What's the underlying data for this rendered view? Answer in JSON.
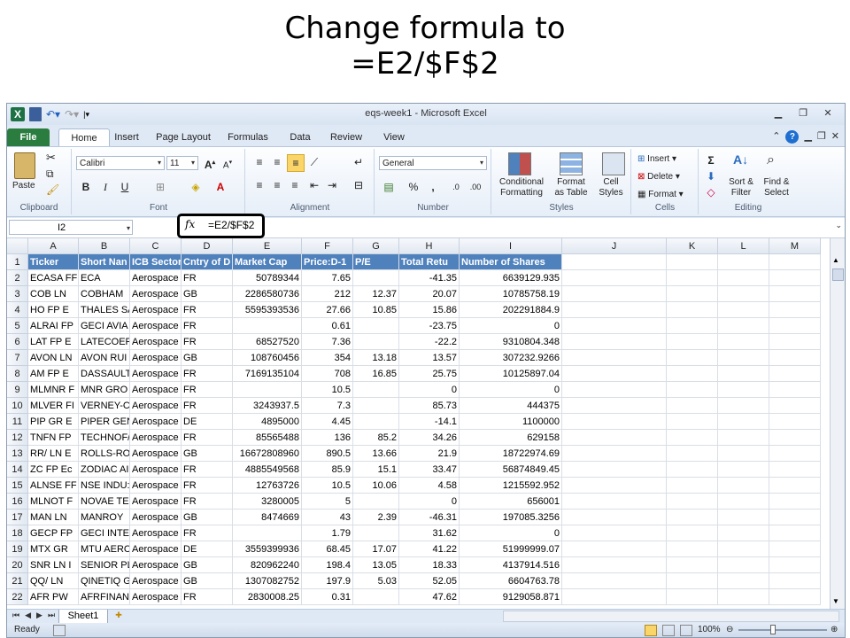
{
  "slide": {
    "title_line1": "Change formula to",
    "title_line2": "=E2/$F$2"
  },
  "window": {
    "title": "eqs-week1 - Microsoft Excel"
  },
  "tabs": {
    "file": "File",
    "home": "Home",
    "insert": "Insert",
    "page_layout": "Page Layout",
    "formulas": "Formulas",
    "data": "Data",
    "review": "Review",
    "view": "View"
  },
  "ribbon": {
    "clipboard": {
      "label": "Clipboard",
      "paste": "Paste"
    },
    "font": {
      "label": "Font",
      "name": "Calibri",
      "size": "11",
      "bold": "B",
      "italic": "I",
      "underline": "U"
    },
    "alignment": {
      "label": "Alignment"
    },
    "number": {
      "label": "Number",
      "format": "General",
      "percent": "%",
      "comma": ","
    },
    "styles": {
      "label": "Styles",
      "conditional_1": "Conditional",
      "conditional_2": "Formatting",
      "format_table_1": "Format",
      "format_table_2": "as Table",
      "cell_styles_1": "Cell",
      "cell_styles_2": "Styles"
    },
    "cells": {
      "label": "Cells",
      "insert": "Insert",
      "delete": "Delete",
      "format": "Format"
    },
    "editing": {
      "label": "Editing",
      "sort_1": "Sort &",
      "sort_2": "Filter",
      "find_1": "Find &",
      "find_2": "Select",
      "sigma": "Σ"
    }
  },
  "formula_bar": {
    "name_box": "I2",
    "fx": "fx",
    "formula": "=E2/$F$2"
  },
  "columns": [
    "A",
    "B",
    "C",
    "D",
    "E",
    "F",
    "G",
    "H",
    "I",
    "J",
    "K",
    "L",
    "M"
  ],
  "header_row": [
    "Ticker",
    "Short Nan",
    "ICB Sector",
    "Cntry of D",
    "Market Cap",
    "Price:D-1",
    "P/E",
    "Total Retu",
    "Number of Shares"
  ],
  "rows": [
    [
      "ECASA  FF",
      "ECA",
      "Aerospace",
      "FR",
      "50789344",
      "7.65",
      "",
      "-41.35",
      "6639129.935"
    ],
    [
      "COB    LN",
      "COBHAM",
      "Aerospace",
      "GB",
      "2286580736",
      "212",
      "12.37",
      "20.07",
      "10785758.19"
    ],
    [
      "HO     FP E",
      "THALES SA",
      "Aerospace",
      "FR",
      "5595393536",
      "27.66",
      "10.85",
      "15.86",
      "202291884.9"
    ],
    [
      "ALRAI  FP",
      "GECI AVIA",
      "Aerospace",
      "FR",
      "",
      "0.61",
      "",
      "-23.75",
      "0"
    ],
    [
      "LAT    FP E",
      "LATECOER",
      "Aerospace",
      "FR",
      "68527520",
      "7.36",
      "",
      "-22.2",
      "9310804.348"
    ],
    [
      "AVON   LN",
      "AVON RUI",
      "Aerospace",
      "GB",
      "108760456",
      "354",
      "13.18",
      "13.57",
      "307232.9266"
    ],
    [
      "AM     FP E",
      "DASSAULT",
      "Aerospace",
      "FR",
      "7169135104",
      "708",
      "16.85",
      "25.75",
      "10125897.04"
    ],
    [
      "MLMNR  F",
      "MNR GRO",
      "Aerospace",
      "FR",
      "",
      "10.5",
      "",
      "0",
      "0"
    ],
    [
      "MLVER  FI",
      "VERNEY-C",
      "Aerospace",
      "FR",
      "3243937.5",
      "7.3",
      "",
      "85.73",
      "444375"
    ],
    [
      "PIP    GR E",
      "PIPER GEN",
      "Aerospace",
      "DE",
      "4895000",
      "4.45",
      "",
      "-14.1",
      "1100000"
    ],
    [
      "TNFN   FP",
      "TECHNOF/",
      "Aerospace",
      "FR",
      "85565488",
      "136",
      "85.2",
      "34.26",
      "629158"
    ],
    [
      "RR/    LN E",
      "ROLLS-RO",
      "Aerospace",
      "GB",
      "16672808960",
      "890.5",
      "13.66",
      "21.9",
      "18722974.69"
    ],
    [
      "ZC     FP Ec",
      "ZODIAC AI",
      "Aerospace",
      "FR",
      "4885549568",
      "85.9",
      "15.1",
      "33.47",
      "56874849.45"
    ],
    [
      "ALNSE  FF",
      "NSE INDU:",
      "Aerospace",
      "FR",
      "12763726",
      "10.5",
      "10.06",
      "4.58",
      "1215592.952"
    ],
    [
      "MLNOT  F",
      "NOVAE TE",
      "Aerospace",
      "FR",
      "3280005",
      "5",
      "",
      "0",
      "656001"
    ],
    [
      "MAN    LN",
      "MANROY",
      "Aerospace",
      "GB",
      "8474669",
      "43",
      "2.39",
      "-46.31",
      "197085.3256"
    ],
    [
      "GECP   FP",
      "GECI INTE",
      "Aerospace",
      "FR",
      "",
      "1.79",
      "",
      "31.62",
      "0"
    ],
    [
      "MTX    GR",
      "MTU AERC",
      "Aerospace",
      "DE",
      "3559399936",
      "68.45",
      "17.07",
      "41.22",
      "51999999.07"
    ],
    [
      "SNR    LN I",
      "SENIOR PL",
      "Aerospace",
      "GB",
      "820962240",
      "198.4",
      "13.05",
      "18.33",
      "4137914.516"
    ],
    [
      "QQ/    LN",
      "QINETIQ G",
      "Aerospace",
      "GB",
      "1307082752",
      "197.9",
      "5.03",
      "52.05",
      "6604763.78"
    ],
    [
      "AFR    PW",
      "AFRFINAN",
      "Aerospace",
      "FR",
      "2830008.25",
      "0.31",
      "",
      "47.62",
      "9129058.871"
    ]
  ],
  "sheet": {
    "tab": "Sheet1"
  },
  "status": {
    "ready": "Ready",
    "zoom": "100%"
  }
}
